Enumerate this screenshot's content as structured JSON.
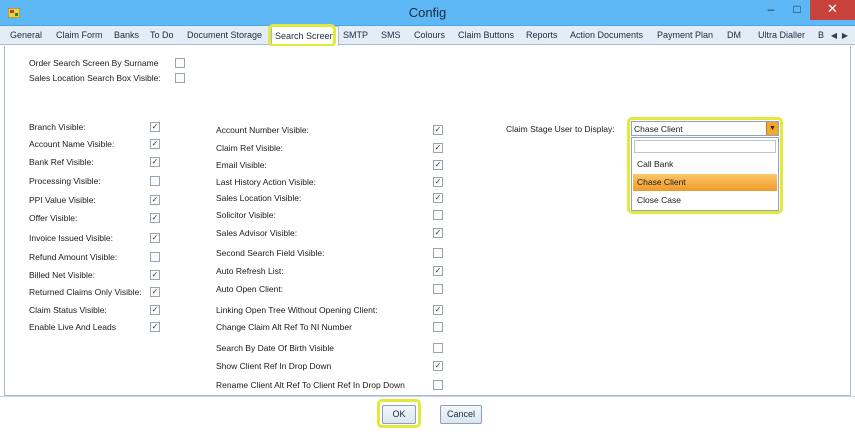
{
  "window": {
    "title": "Config",
    "min_glyph": "–",
    "max_glyph": "□",
    "close_glyph": "✕"
  },
  "tabs": [
    "General",
    "Claim Form",
    "Banks",
    "To Do",
    "Document Storage",
    "Search Screen",
    "SMTP",
    "SMS",
    "Colours",
    "Claim Buttons",
    "Reports",
    "Action Documents",
    "Payment Plan",
    "DM",
    "Ultra Dialler",
    "B"
  ],
  "active_tab": "Search Screen",
  "scroll_arrows": {
    "left": "◀",
    "right": "▶"
  },
  "top_options": [
    {
      "label": "Order Search Screen By Surname",
      "checked": false
    },
    {
      "label": "Sales Location Search Box Visible:",
      "checked": false
    }
  ],
  "col1": [
    {
      "label": "Branch Visible:",
      "checked": true
    },
    {
      "label": "Account Name Visible:",
      "checked": true
    },
    {
      "label": "Bank Ref Visible:",
      "checked": true
    },
    {
      "label": "Processing Visible:",
      "checked": false
    },
    {
      "label": "PPI Value Visible:",
      "checked": true
    },
    {
      "label": "Offer Visible:",
      "checked": true
    },
    {
      "label": "Invoice Issued Visible:",
      "checked": true
    },
    {
      "label": "Refund Amount Visible:",
      "checked": false
    },
    {
      "label": "Billed Net Visible:",
      "checked": true
    },
    {
      "label": "Returned Claims Only Visible:",
      "checked": true
    },
    {
      "label": "Claim Status Visible:",
      "checked": true
    },
    {
      "label": "Enable Live And Leads",
      "checked": true
    }
  ],
  "col2": [
    {
      "label": "Account Number Visible:",
      "checked": true
    },
    {
      "label": "Claim Ref Visible:",
      "checked": true
    },
    {
      "label": "Email Visible:",
      "checked": true
    },
    {
      "label": "Last History Action Visible:",
      "checked": true
    },
    {
      "label": "Sales Location Visible:",
      "checked": true
    },
    {
      "label": "Solicitor Visible:",
      "checked": false
    },
    {
      "label": "Sales Advisor Visible:",
      "checked": true
    },
    {
      "label": "Second Search Field Visible:",
      "checked": false
    },
    {
      "label": "Auto Refresh List:",
      "checked": true
    },
    {
      "label": "Auto Open Client:",
      "checked": false
    },
    {
      "label": "Linking Open Tree Without Opening Client:",
      "checked": true
    },
    {
      "label": "Change Claim Alt Ref To NI Number",
      "checked": false
    },
    {
      "label": "Search By Date Of Birth Visible",
      "checked": false
    },
    {
      "label": "Show Client Ref In Drop Down",
      "checked": true
    },
    {
      "label": "Rename Client Alt Ref To Client Ref In Drop Down",
      "checked": false
    }
  ],
  "claim_stage": {
    "label": "Claim Stage User to Display:",
    "selected": "Chase Client",
    "search_value": "",
    "options": [
      "Call Bank",
      "Chase Client",
      "Close Case"
    ]
  },
  "buttons": {
    "ok": "OK",
    "cancel": "Cancel"
  },
  "check_glyph": "✓",
  "colors": {
    "titlebar": "#5eb8f6",
    "highlight": "#e3e93a",
    "selection": "#f09a28",
    "close": "#c8423c"
  }
}
